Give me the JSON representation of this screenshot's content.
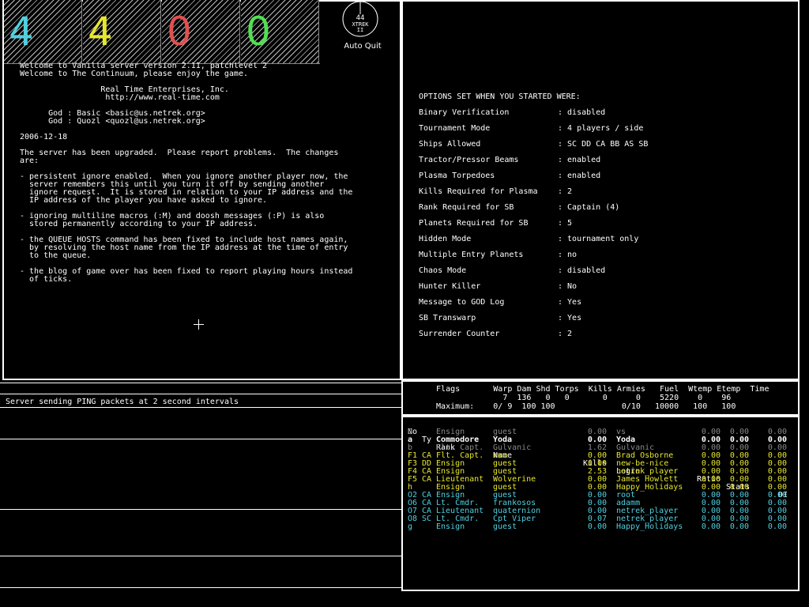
{
  "teams": [
    {
      "label": "4",
      "color": "#4fd0e0"
    },
    {
      "label": "4",
      "color": "#e6e62e"
    },
    {
      "label": "0",
      "color": "#e05050"
    },
    {
      "label": "0",
      "color": "#50e050"
    }
  ],
  "clock": {
    "number": "44",
    "title": "XTREK",
    "sub": "II",
    "quit_label": "Auto Quit"
  },
  "motd": {
    "lines": [
      "Welcome to Vanilla server version 2.11, patchlevel 2",
      "Welcome to The Continuum, please enjoy the game.",
      "",
      "                 Real Time Enterprises, Inc.",
      "                  http://www.real-time.com",
      "",
      "      God : Basic <basic@us.netrek.org>",
      "      God : Quozl <quozl@us.netrek.org>",
      "",
      "2006-12-18",
      "",
      "The server has been upgraded.  Please report problems.  The changes",
      "are:",
      "",
      "- persistent ignore enabled.  When you ignore another player now, the",
      "  server remembers this until you turn it off by sending another",
      "  ignore request.  It is stored in relation to your IP address and the",
      "  IP address of the player you have asked to ignore.",
      "",
      "- ignoring multiline macros (:M) and doosh messages (:P) is also",
      "  stored permanently according to your IP address.",
      "",
      "- the QUEUE HOSTS command has been fixed to include host names again,",
      "  by resolving the host name from the IP address at the time of entry",
      "  to the queue.",
      "",
      "- the blog of game over has been fixed to report playing hours instead",
      "  of ticks."
    ]
  },
  "options": {
    "header": "OPTIONS SET WHEN YOU STARTED WERE:",
    "rows": [
      {
        "label": "Binary Verification",
        "value": ": disabled"
      },
      {
        "label": "Tournament Mode",
        "value": ": 4 players / side"
      },
      {
        "label": "Ships Allowed",
        "value": ": SC DD CA BB AS SB"
      },
      {
        "label": "Tractor/Pressor Beams",
        "value": ": enabled"
      },
      {
        "label": "Plasma Torpedoes",
        "value": ": enabled"
      },
      {
        "label": "Kills Required for Plasma",
        "value": ": 2"
      },
      {
        "label": "Rank Required for SB",
        "value": ": Captain (4)"
      },
      {
        "label": "Planets Required for SB",
        "value": ": 5"
      },
      {
        "label": "Hidden Mode",
        "value": ": tournament only"
      },
      {
        "label": "Multiple Entry Planets",
        "value": ": no"
      },
      {
        "label": "Chaos Mode",
        "value": ": disabled"
      },
      {
        "label": "Hunter Killer",
        "value": ": No"
      },
      {
        "label": "Message to GOD Log",
        "value": ": Yes"
      },
      {
        "label": "SB Transwarp",
        "value": ": Yes"
      },
      {
        "label": "Surrender Counter",
        "value": ": 2"
      }
    ]
  },
  "messages": {
    "line1": "Server sending PING packets at 2 second intervals"
  },
  "stats": {
    "header": "  Flags       Warp Dam Shd Torps  Kills Armies   Fuel  Wtemp Etemp  Time",
    "current": "                7  136   0   0       0      0    5220    0    96",
    "maximum": "  Maximum:    0/ 9  100 100              0/10   10000   100   100"
  },
  "players": {
    "headers": {
      "no": "No",
      "ty": "Ty",
      "rank": "Rank",
      "name": "Name",
      "kills": "Kills",
      "login": "Login",
      "ratio": "Ratio",
      "stats": "Stats",
      "di": "DI"
    },
    "rows": [
      {
        "no": "0",
        "ty": "",
        "rank": "Ensign",
        "name": "guest",
        "kills": "0.00",
        "login": "vs",
        "ratio": "0.00",
        "stats": "0.00",
        "di": "0.00",
        "color": "#888888",
        "bold": false
      },
      {
        "no": "a",
        "ty": "",
        "rank": "Commodore",
        "name": "Yoda",
        "kills": "0.00",
        "login": "Yoda",
        "ratio": "0.00",
        "stats": "0.00",
        "di": "0.00",
        "color": "#ffffff",
        "bold": true
      },
      {
        "no": "b",
        "ty": "",
        "rank": "Flt. Capt.",
        "name": "Gulvanic",
        "kills": "1.62",
        "login": "Gulvanic",
        "ratio": "0.00",
        "stats": "0.00",
        "di": "0.00",
        "color": "#888888",
        "bold": false
      },
      {
        "no": "F1",
        "ty": "CA",
        "rank": "Flt. Capt.",
        "name": "rmo",
        "kills": "0.00",
        "login": "Brad Osborne",
        "ratio": "0.00",
        "stats": "0.00",
        "di": "0.00",
        "color": "#e6e62e",
        "bold": false
      },
      {
        "no": "F3",
        "ty": "DD",
        "rank": "Ensign",
        "name": "guest",
        "kills": "0.00",
        "login": "new-be-nice",
        "ratio": "0.00",
        "stats": "0.00",
        "di": "0.00",
        "color": "#e6e62e",
        "bold": false
      },
      {
        "no": "F4",
        "ty": "CA",
        "rank": "Ensign",
        "name": "guest",
        "kills": "2.53",
        "login": "netrek_player",
        "ratio": "0.00",
        "stats": "0.00",
        "di": "0.00",
        "color": "#e6e62e",
        "bold": false
      },
      {
        "no": "F5",
        "ty": "CA",
        "rank": "Lieutenant",
        "name": "Wolverine",
        "kills": "0.00",
        "login": "James Howlett",
        "ratio": "0.00",
        "stats": "0.00",
        "di": "0.00",
        "color": "#e6e62e",
        "bold": false
      },
      {
        "no": "h",
        "ty": "",
        "rank": "Ensign",
        "name": "guest",
        "kills": "0.00",
        "login": "Happy_Holidays",
        "ratio": "0.00",
        "stats": "0.00",
        "di": "0.00",
        "color": "#e6e62e",
        "bold": false
      },
      {
        "no": "O2",
        "ty": "CA",
        "rank": "Ensign",
        "name": "guest",
        "kills": "0.00",
        "login": "root",
        "ratio": "0.00",
        "stats": "0.00",
        "di": "0.00",
        "color": "#4fd0e0",
        "bold": false
      },
      {
        "no": "O6",
        "ty": "CA",
        "rank": "Lt. Cmdr.",
        "name": "frankosos",
        "kills": "0.00",
        "login": "adamm",
        "ratio": "0.00",
        "stats": "0.00",
        "di": "0.00",
        "color": "#4fd0e0",
        "bold": false
      },
      {
        "no": "O7",
        "ty": "CA",
        "rank": "Lieutenant",
        "name": "quaternion",
        "kills": "0.00",
        "login": "netrek_player",
        "ratio": "0.00",
        "stats": "0.00",
        "di": "0.00",
        "color": "#4fd0e0",
        "bold": false
      },
      {
        "no": "O8",
        "ty": "SC",
        "rank": "Lt. Cmdr.",
        "name": "Cpt Viper",
        "kills": "0.07",
        "login": "netrek_player",
        "ratio": "0.00",
        "stats": "0.00",
        "di": "0.00",
        "color": "#4fd0e0",
        "bold": false
      },
      {
        "no": "g",
        "ty": "",
        "rank": "Ensign",
        "name": "guest",
        "kills": "0.00",
        "login": "Happy_Holidays",
        "ratio": "0.00",
        "stats": "0.00",
        "di": "0.00",
        "color": "#4fd0e0",
        "bold": false
      }
    ]
  }
}
